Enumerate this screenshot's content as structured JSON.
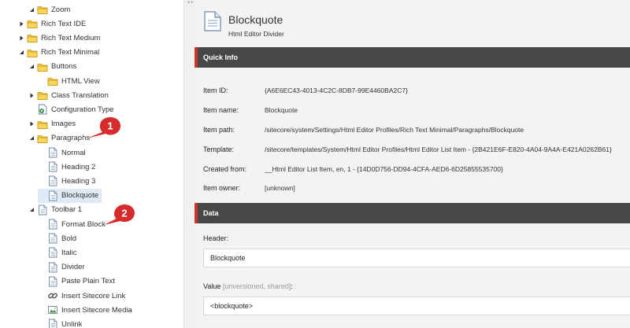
{
  "tree": {
    "items": [
      {
        "label": "Zoom",
        "expander": "expanded",
        "icon": "folder-icon"
      },
      {
        "label": "Rich Text IDE",
        "expander": "collapsed",
        "icon": "folder-icon"
      },
      {
        "label": "Rich Text Medium",
        "expander": "collapsed",
        "icon": "folder-icon"
      },
      {
        "label": "Rich Text Minimal",
        "expander": "expanded",
        "icon": "folder-icon"
      },
      {
        "label": "Buttons",
        "expander": "expanded",
        "icon": "folder-icon"
      },
      {
        "label": "HTML View",
        "expander": "none",
        "icon": "folder-icon"
      },
      {
        "label": "Class Translation",
        "expander": "collapsed",
        "icon": "folder-icon"
      },
      {
        "label": "Configuration Type",
        "expander": "none",
        "icon": "config-icon"
      },
      {
        "label": "Images",
        "expander": "collapsed",
        "icon": "folder-icon"
      },
      {
        "label": "Paragraphs",
        "expander": "expanded",
        "icon": "folder-icon"
      },
      {
        "label": "Normal",
        "expander": "none",
        "icon": "document-icon"
      },
      {
        "label": "Heading 2",
        "expander": "none",
        "icon": "document-icon"
      },
      {
        "label": "Heading 3",
        "expander": "none",
        "icon": "document-icon"
      },
      {
        "label": "Blockquote",
        "expander": "none",
        "icon": "document-icon"
      },
      {
        "label": "Toolbar 1",
        "expander": "expanded",
        "icon": "document-icon"
      },
      {
        "label": "Format Block",
        "expander": "none",
        "icon": "document-icon"
      },
      {
        "label": "Bold",
        "expander": "none",
        "icon": "document-icon"
      },
      {
        "label": "Italic",
        "expander": "none",
        "icon": "document-icon"
      },
      {
        "label": "Divider",
        "expander": "none",
        "icon": "document-icon"
      },
      {
        "label": "Paste Plain Text",
        "expander": "none",
        "icon": "document-icon"
      },
      {
        "label": "Insert Sitecore Link",
        "expander": "none",
        "icon": "link-icon"
      },
      {
        "label": "Insert Sitecore Media",
        "expander": "none",
        "icon": "media-icon"
      },
      {
        "label": "Unlink",
        "expander": "none",
        "icon": "document-icon"
      }
    ],
    "selected": "Blockquote"
  },
  "callouts": [
    "1",
    "2"
  ],
  "item": {
    "title": "Blockquote",
    "subtitle": "Html Editor Divider",
    "icon": "document-icon"
  },
  "quick_info": {
    "heading": "Quick Info",
    "rows": [
      {
        "key": "Item ID:",
        "value": "{A6E6EC43-4013-4C2C-8DB7-99E4460BA2C7}"
      },
      {
        "key": "Item name:",
        "value": "Blockquote"
      },
      {
        "key": "Item path:",
        "value": "/sitecore/system/Settings/Html Editor Profiles/Rich Text Minimal/Paragraphs/Blockquote"
      },
      {
        "key": "Template:",
        "value": "/sitecore/templates/System/Html Editor Profiles/Html Editor List Item - {2B421E6F-E820-4A04-9A4A-E421A0262B61}"
      },
      {
        "key": "Created from:",
        "value": "__Html Editor List Item, en, 1 - {14D0D756-DD94-4CFA-AED6-6D25855535700}"
      },
      {
        "key": "Item owner:",
        "value": "[unknown]"
      }
    ]
  },
  "data_section": {
    "heading": "Data",
    "header_label": "Header:",
    "header_value": "Blockquote",
    "value_label": "Value",
    "value_meta": "[unversioned, shared]",
    "value_colon": ":",
    "value_value": "<blockquote>"
  },
  "colors": {
    "section_bar": "#474747",
    "section_accent": "#c8342a",
    "callout_red": "#d62b2b",
    "selected_row": "#dfeaf6"
  }
}
